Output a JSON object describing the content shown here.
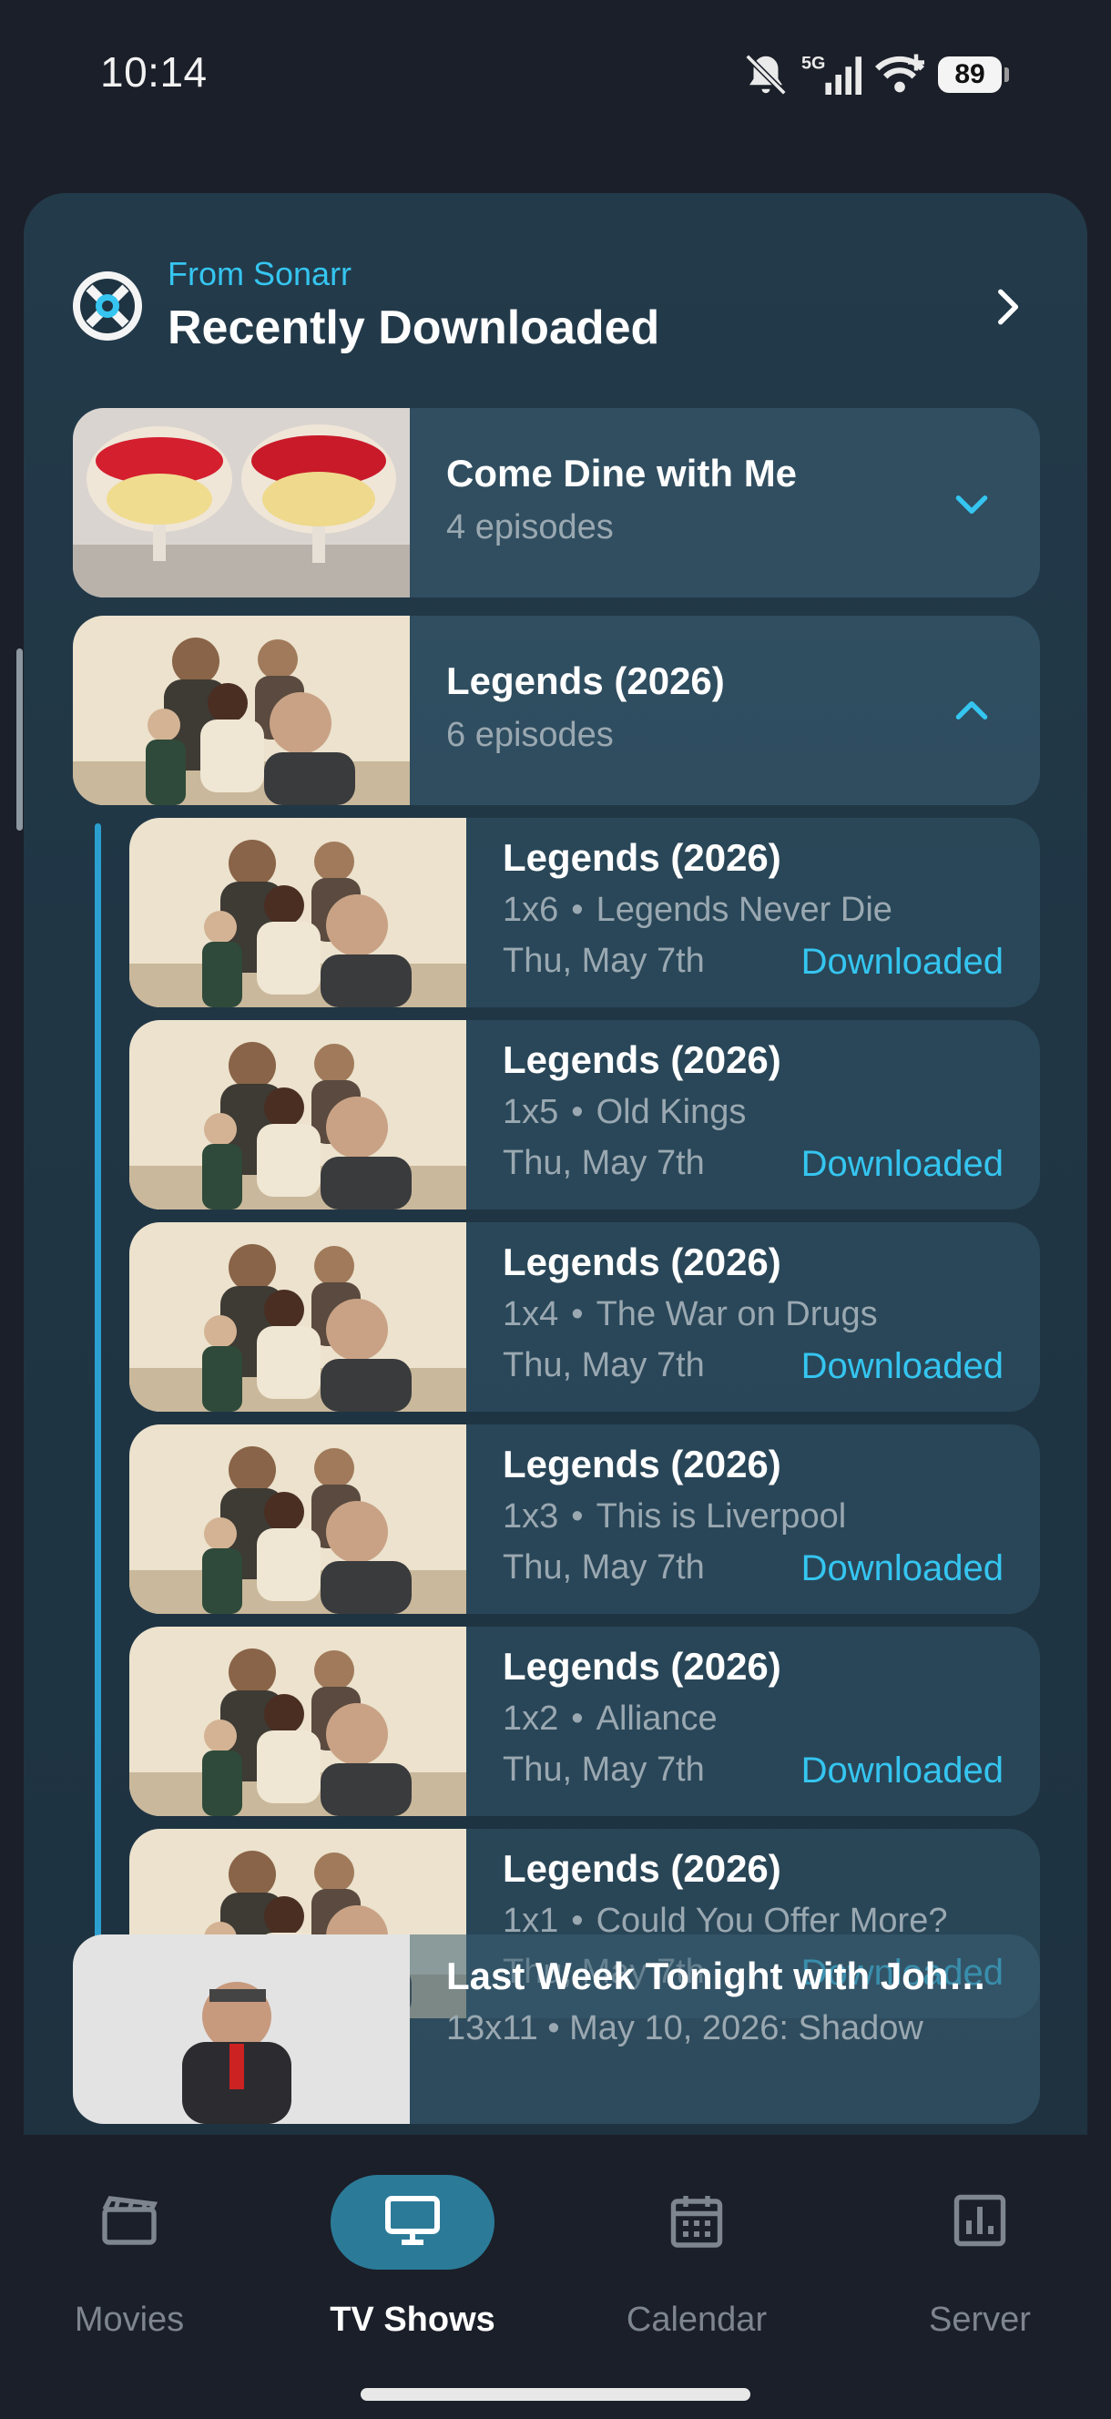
{
  "status_bar": {
    "time": "10:14",
    "network": "5G",
    "battery": "89"
  },
  "card": {
    "source_label": "From Sonarr",
    "title": "Recently Downloaded"
  },
  "groups": [
    {
      "title": "Come Dine with Me",
      "subtitle": "4 episodes",
      "expanded": false
    },
    {
      "title": "Legends (2026)",
      "subtitle": "6 episodes",
      "expanded": true
    }
  ],
  "episodes": [
    {
      "show": "Legends (2026)",
      "code": "1x6",
      "name": "Legends Never Die",
      "date": "Thu, May 7th",
      "status": "Downloaded"
    },
    {
      "show": "Legends (2026)",
      "code": "1x5",
      "name": "Old Kings",
      "date": "Thu, May 7th",
      "status": "Downloaded"
    },
    {
      "show": "Legends (2026)",
      "code": "1x4",
      "name": "The War on Drugs",
      "date": "Thu, May 7th",
      "status": "Downloaded"
    },
    {
      "show": "Legends (2026)",
      "code": "1x3",
      "name": "This is Liverpool",
      "date": "Thu, May 7th",
      "status": "Downloaded"
    },
    {
      "show": "Legends (2026)",
      "code": "1x2",
      "name": "Alliance",
      "date": "Thu, May 7th",
      "status": "Downloaded"
    },
    {
      "show": "Legends (2026)",
      "code": "1x1",
      "name": "Could You Offer More?",
      "date": "Thu, May 7th",
      "status": "Downloaded"
    }
  ],
  "partial_group": {
    "title": "Last Week Tonight with Joh…",
    "subtitle": "13x11 • May 10, 2026: Shadow"
  },
  "nav": {
    "items": [
      {
        "label": "Movies",
        "icon": "clapperboard-icon"
      },
      {
        "label": "TV Shows",
        "icon": "tv-icon"
      },
      {
        "label": "Calendar",
        "icon": "calendar-icon"
      },
      {
        "label": "Server",
        "icon": "chart-icon"
      }
    ],
    "active": "TV Shows"
  },
  "colors": {
    "accent": "#35c5f0",
    "card": "#233a4a",
    "nav_active": "#2b7b98",
    "background": "#1b1f29"
  }
}
